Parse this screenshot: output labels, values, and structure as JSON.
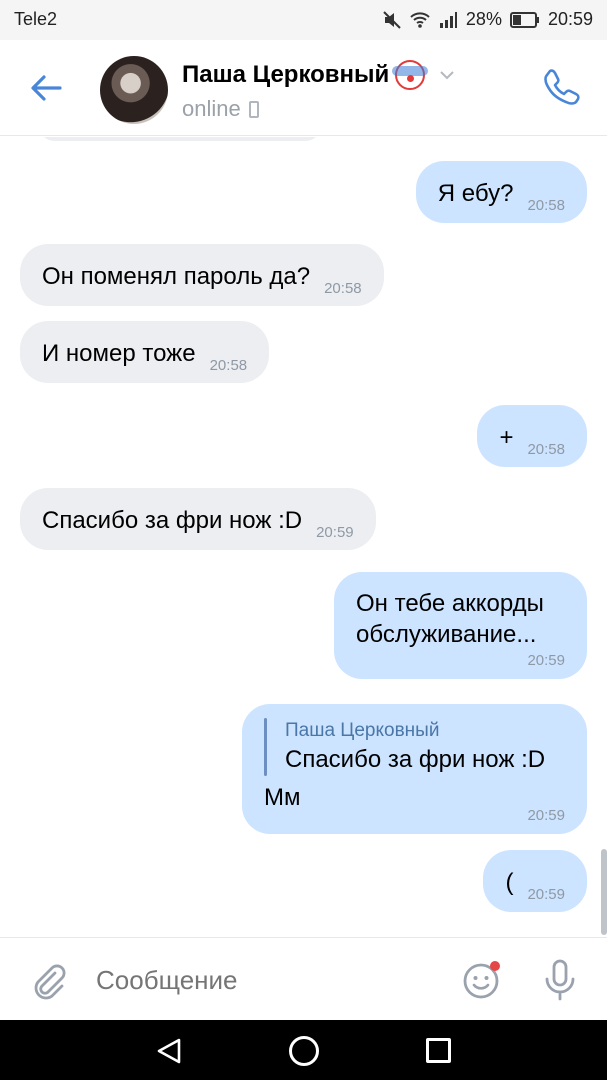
{
  "status_bar": {
    "carrier": "Tele2",
    "battery": "28%",
    "time": "20:59",
    "icons": [
      "mute-icon",
      "wifi-icon",
      "signal-icon",
      "battery-icon"
    ]
  },
  "header": {
    "contact_name": "Паша Церковный",
    "status": "online",
    "emoji": "clown-icon"
  },
  "messages": [
    {
      "dir": "out",
      "text": "Я ебу?",
      "time": "20:58"
    },
    {
      "dir": "in",
      "text": "Он поменял пароль да?",
      "time": "20:58"
    },
    {
      "dir": "in",
      "text": "И номер тоже",
      "time": "20:58"
    },
    {
      "dir": "out",
      "text": "+",
      "time": "20:58"
    },
    {
      "dir": "in",
      "text": "Спасибо за фри нож :D",
      "time": "20:59"
    },
    {
      "dir": "out",
      "text_lines": [
        "Он тебе аккорды",
        "обслуживание..."
      ],
      "time": "20:59"
    },
    {
      "dir": "out",
      "reply": {
        "author": "Паша Церковный",
        "text": "Спасибо за фри нож :D"
      },
      "text": "Мм",
      "time": "20:59"
    },
    {
      "dir": "out",
      "text": "(",
      "time": "20:59"
    }
  ],
  "composer": {
    "placeholder": "Сообщение"
  },
  "colors": {
    "accent": "#4a76a8",
    "outgoing_bubble": "#cce4ff",
    "incoming_bubble": "#eceef2"
  }
}
